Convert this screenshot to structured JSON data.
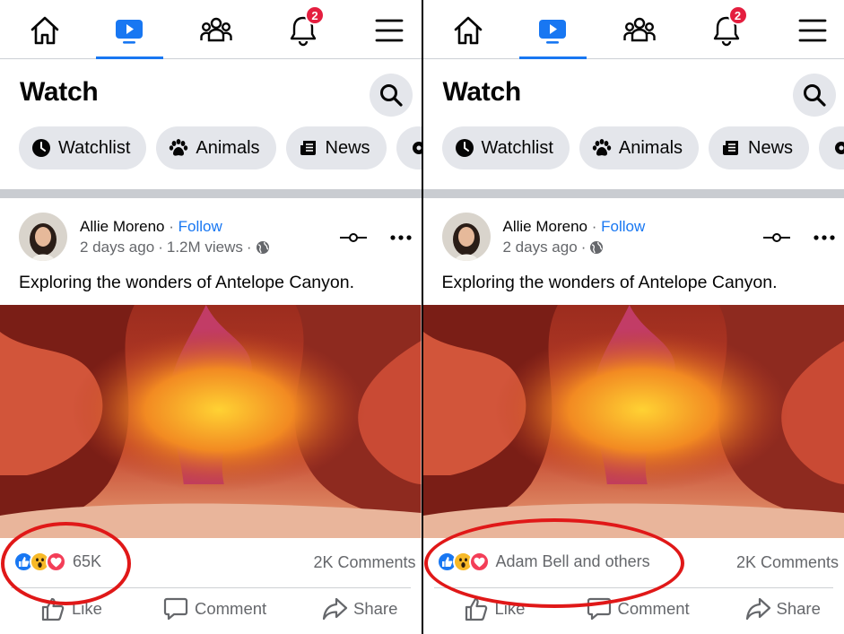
{
  "colors": {
    "accent": "#1877f2",
    "badge": "#e41e3f",
    "highlight_circle": "#e01818",
    "secondary_text": "#65676b",
    "chip_bg": "#e4e6eb"
  },
  "panels": [
    {
      "nav": {
        "items": [
          {
            "icon": "home-icon"
          },
          {
            "icon": "watch-icon",
            "active": true
          },
          {
            "icon": "groups-icon"
          },
          {
            "icon": "bell-icon",
            "badge": "2"
          },
          {
            "icon": "menu-icon"
          }
        ]
      },
      "header": {
        "title": "Watch",
        "search_icon": "search-icon"
      },
      "chips": [
        {
          "label": "Watchlist",
          "icon": "clock-icon"
        },
        {
          "label": "Animals",
          "icon": "paw-icon"
        },
        {
          "label": "News",
          "icon": "newspaper-icon"
        }
      ],
      "post": {
        "author": "Allie Moreno",
        "separator": "·",
        "follow": "Follow",
        "time": "2 days ago",
        "views": "1.2M views",
        "caption": "Exploring the wonders of Antelope Canyon.",
        "reactions_text": "65K",
        "comments": "2K Comments",
        "actions": {
          "like": "Like",
          "comment": "Comment",
          "share": "Share"
        }
      }
    },
    {
      "nav": {
        "items": [
          {
            "icon": "home-icon"
          },
          {
            "icon": "watch-icon",
            "active": true
          },
          {
            "icon": "groups-icon"
          },
          {
            "icon": "bell-icon",
            "badge": "2"
          },
          {
            "icon": "menu-icon"
          }
        ]
      },
      "header": {
        "title": "Watch",
        "search_icon": "search-icon"
      },
      "chips": [
        {
          "label": "Watchlist",
          "icon": "clock-icon"
        },
        {
          "label": "Animals",
          "icon": "paw-icon"
        },
        {
          "label": "News",
          "icon": "newspaper-icon"
        }
      ],
      "post": {
        "author": "Allie Moreno",
        "separator": "·",
        "follow": "Follow",
        "time": "2 days ago",
        "views": "",
        "caption": "Exploring the wonders of Antelope Canyon.",
        "reactions_text": "Adam Bell and others",
        "comments": "2K Comments",
        "actions": {
          "like": "Like",
          "comment": "Comment",
          "share": "Share"
        }
      }
    }
  ]
}
